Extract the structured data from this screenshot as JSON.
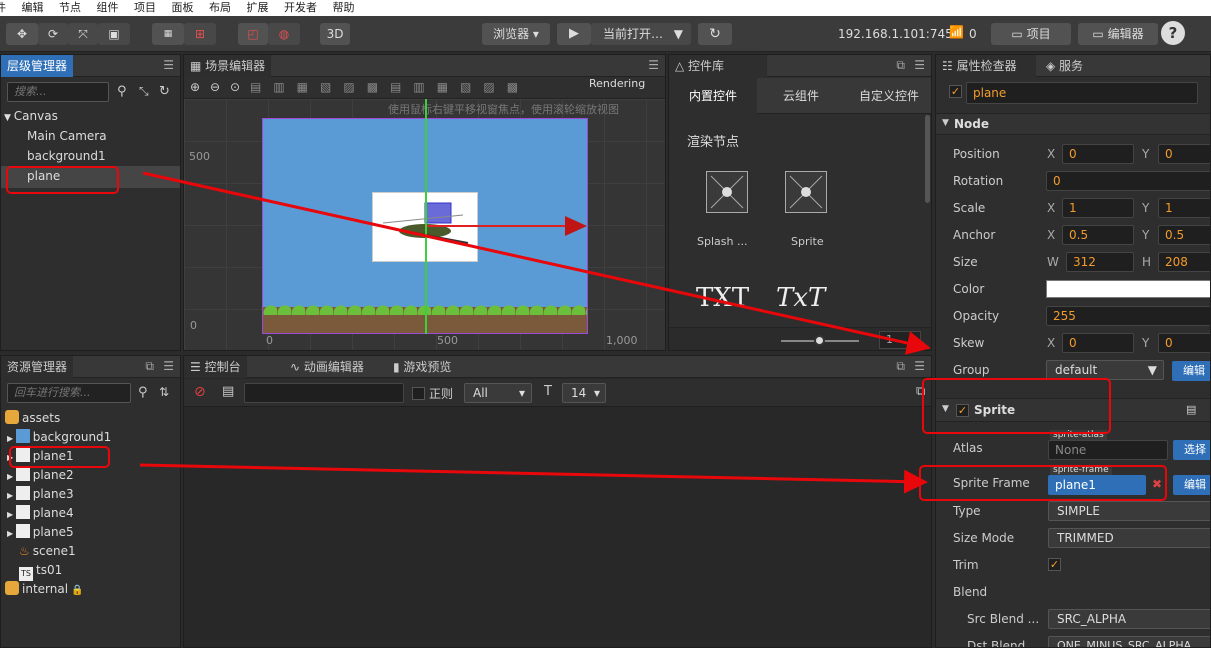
{
  "menubar": {
    "items": [
      "件",
      "编辑",
      "节点",
      "组件",
      "项目",
      "面板",
      "布局",
      "扩展",
      "开发者",
      "帮助"
    ]
  },
  "toolbar": {
    "mode_3d": "3D",
    "browser": "浏览器 ▾",
    "play_target": "当前打开…",
    "ip": "192.168.1.101:7456",
    "connections": "0",
    "project_btn": "项目",
    "editor_btn": "编辑器",
    "help": "?"
  },
  "hierarchy": {
    "title": "层级管理器",
    "search_placeholder": "搜索...",
    "items": [
      "Canvas",
      "Main Camera",
      "background1",
      "plane"
    ]
  },
  "scene": {
    "title": "场景编辑器",
    "rendering": "Rendering",
    "hint": "使用鼠标右键平移视窗焦点，使用滚轮缩放视图",
    "tick_500_y": "500",
    "tick_0_y": "0",
    "tick_0_x": "0",
    "tick_500_x": "500",
    "tick_1000_x": "1,000"
  },
  "widgets": {
    "title": "控件库",
    "tabs": [
      "内置控件",
      "云组件",
      "自定义控件"
    ],
    "section": "渲染节点",
    "items": [
      "Splash ...",
      "Sprite"
    ],
    "text_items": [
      "TXT",
      "TxT"
    ],
    "zoom_value": "1"
  },
  "assets": {
    "title": "资源管理器",
    "search_placeholder": "回车进行搜索...",
    "root": "assets",
    "items": [
      "background1",
      "plane1",
      "plane2",
      "plane3",
      "plane4",
      "plane5",
      "scene1",
      "ts01"
    ],
    "internal": "internal"
  },
  "console": {
    "tabs": [
      "控制台",
      "动画编辑器",
      "游戏预览"
    ],
    "regex": "正则",
    "level": "All",
    "font_size": "14"
  },
  "inspector": {
    "tabs": [
      "属性检查器",
      "服务"
    ],
    "node_name": "plane",
    "node_section": "Node",
    "position": {
      "label": "Position",
      "x": "0",
      "y": "0"
    },
    "rotation": {
      "label": "Rotation",
      "value": "0"
    },
    "scale": {
      "label": "Scale",
      "x": "1",
      "y": "1"
    },
    "anchor": {
      "label": "Anchor",
      "x": "0.5",
      "y": "0.5"
    },
    "size": {
      "label": "Size",
      "w": "312",
      "h": "208"
    },
    "color": {
      "label": "Color",
      "value": "#ffffff"
    },
    "opacity": {
      "label": "Opacity",
      "value": "255"
    },
    "skew": {
      "label": "Skew",
      "x": "0",
      "y": "0"
    },
    "group": {
      "label": "Group",
      "value": "default",
      "button": "编辑"
    },
    "sprite_section": "Sprite",
    "atlas": {
      "label": "Atlas",
      "tag": "sprite-atlas",
      "value": "None",
      "button": "选择"
    },
    "sprite_frame": {
      "label": "Sprite Frame",
      "tag": "sprite-frame",
      "value": "plane1",
      "button": "编辑"
    },
    "type": {
      "label": "Type",
      "value": "SIMPLE"
    },
    "size_mode": {
      "label": "Size Mode",
      "value": "TRIMMED"
    },
    "trim": {
      "label": "Trim"
    },
    "blend": {
      "label": "Blend"
    },
    "src_blend": {
      "label": "Src Blend ...",
      "value": "SRC_ALPHA"
    },
    "dst_blend": {
      "label": "Dst Blend",
      "value": "ONE_MINUS_SRC_ALPHA"
    }
  },
  "axis_labels": {
    "x": "X",
    "y": "Y",
    "w": "W",
    "h": "H"
  },
  "colors": {
    "accent_blue": "#2e6fb8",
    "value_orange": "#f39c2c",
    "annotation_red": "#e8070a",
    "sky_blue": "#5b9bd5"
  }
}
